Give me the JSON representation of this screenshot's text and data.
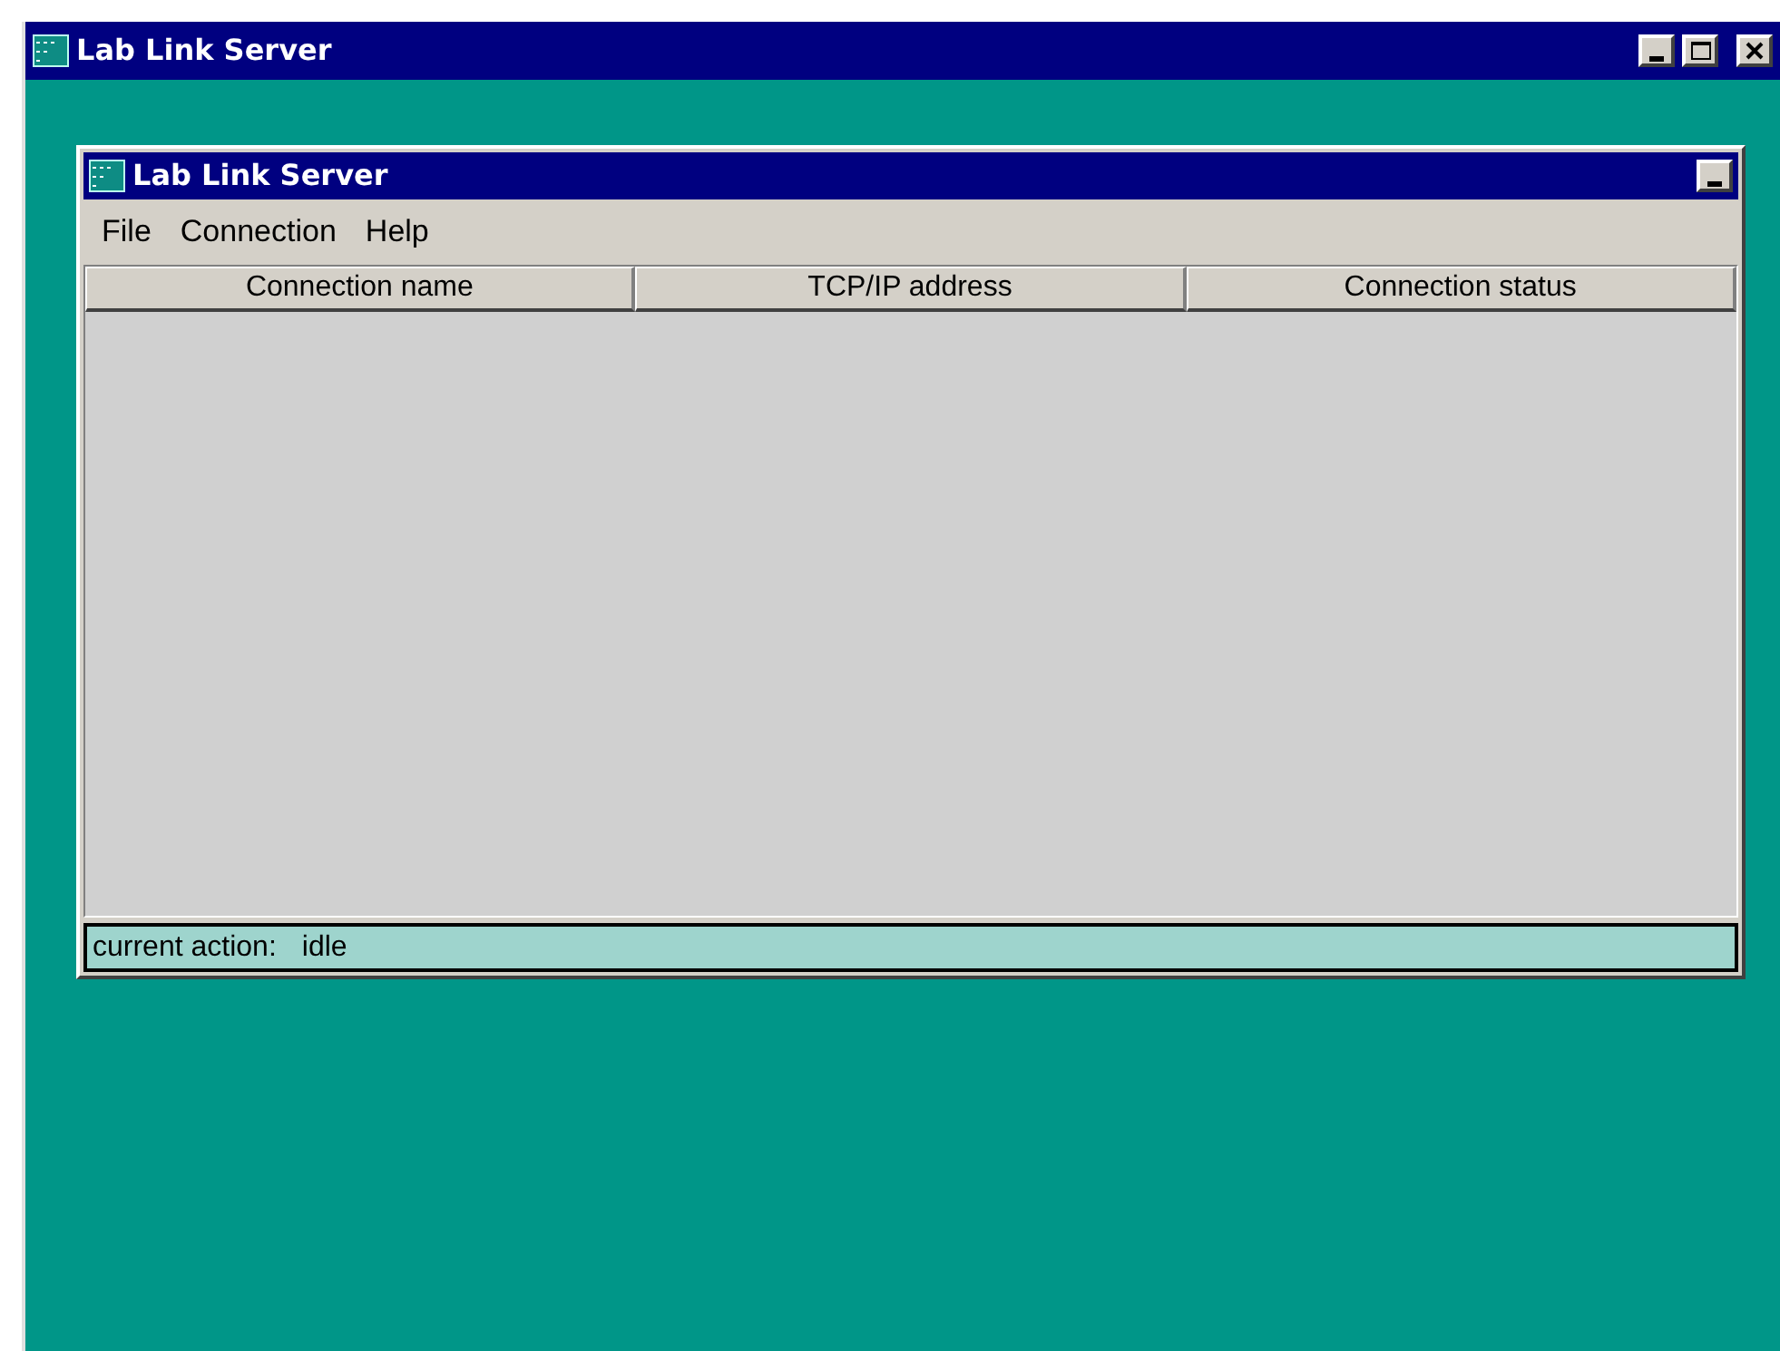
{
  "window": {
    "title": "Lab Link Server"
  },
  "inner_window": {
    "title": "Lab Link Server"
  },
  "menu": [
    "File",
    "Connection",
    "Help"
  ],
  "table": {
    "columns": [
      "Connection name",
      "TCP/IP address",
      "Connection status"
    ]
  },
  "status_bar": {
    "label": "current action:",
    "value": "idle"
  }
}
